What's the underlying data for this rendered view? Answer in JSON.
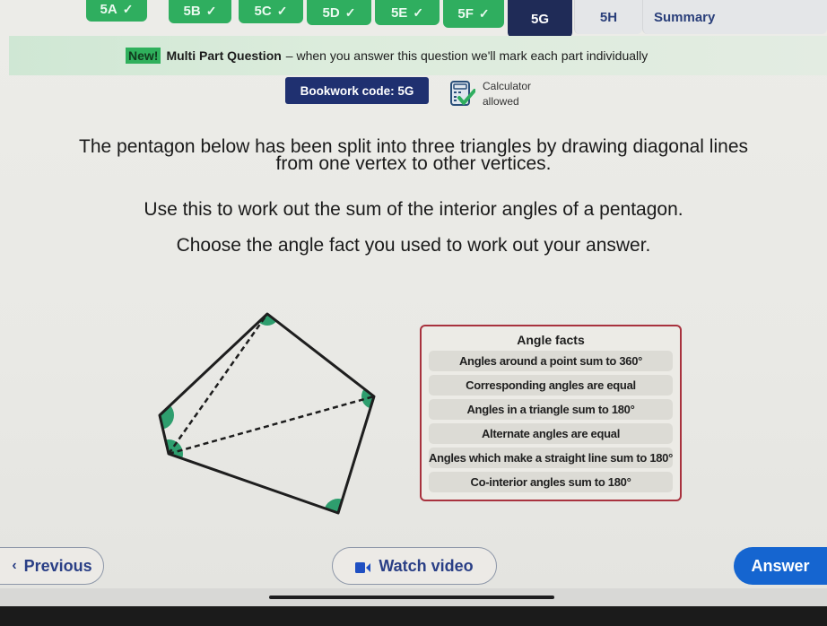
{
  "tabs": [
    {
      "label": "5A",
      "status": "completed",
      "check_icon": "✓"
    },
    {
      "label": "5B",
      "status": "completed",
      "check_icon": "✓"
    },
    {
      "label": "5C",
      "status": "completed",
      "check_icon": "✓"
    },
    {
      "label": "5D",
      "status": "completed",
      "check_icon": "✓"
    },
    {
      "label": "5E",
      "status": "completed",
      "check_icon": "✓"
    },
    {
      "label": "5F",
      "status": "completed",
      "check_icon": "✓"
    },
    {
      "label": "5G",
      "status": "active"
    },
    {
      "label": "5H",
      "status": "todo"
    },
    {
      "label": "Summary",
      "status": "todo"
    }
  ],
  "banner": {
    "badge": "New!",
    "title": "Multi Part Question",
    "text": "– when you answer this question we'll mark each part individually"
  },
  "bookwork": {
    "label": "Bookwork code: 5G"
  },
  "calculator": {
    "line1": "Calculator",
    "line2": "allowed",
    "icon": "calculator-check-icon"
  },
  "question": {
    "line1": "The pentagon below has been split into three triangles by drawing diagonal lines",
    "line2": "from one vertex to other vertices.",
    "line3": "Use this to work out the sum of the interior angles of a pentagon.",
    "line4": "Choose the angle fact you used to work out your answer."
  },
  "diagram": {
    "shape": "pentagon",
    "triangles": 3,
    "angle_marker_color": "#2e9e6e",
    "outline_color": "#1e1e1e"
  },
  "angle_facts": {
    "title": "Angle facts",
    "options": [
      "Angles around a point sum to 360°",
      "Corresponding angles are equal",
      "Angles in a triangle sum to 180°",
      "Alternate angles are equal",
      "Angles which make a straight line sum to 180°",
      "Co-interior angles sum to 180°"
    ]
  },
  "nav": {
    "previous": "Previous",
    "watch_video": "Watch video",
    "answer": "Answer"
  },
  "colors": {
    "completed_tab": "#2fae5f",
    "active_tab": "#1f2b57",
    "primary_button": "#1565d0",
    "facts_border": "#a8323e"
  }
}
